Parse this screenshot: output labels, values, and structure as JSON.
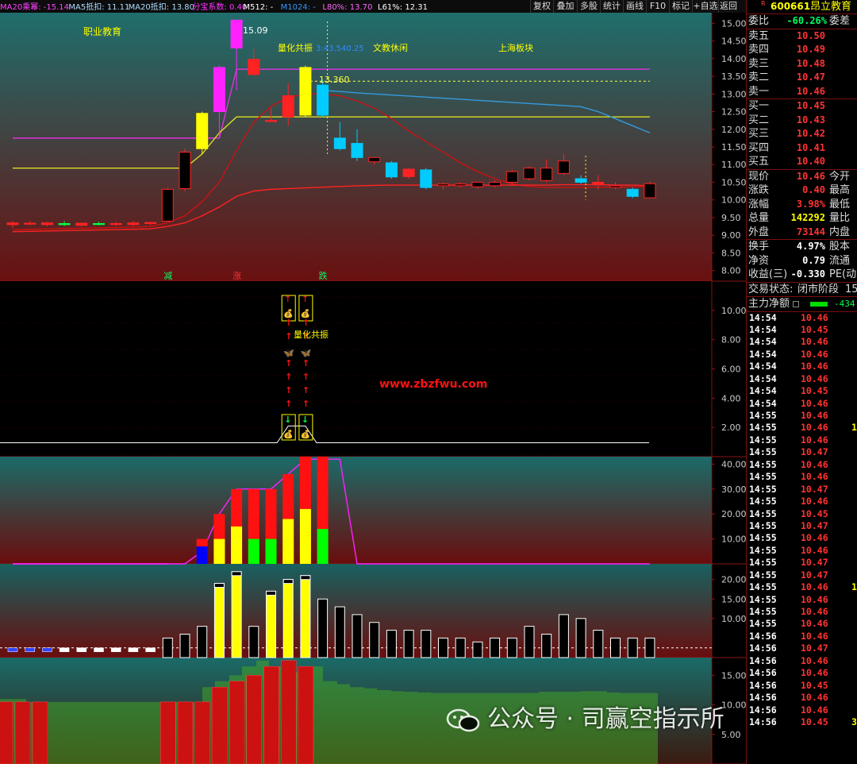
{
  "toolbar": {
    "indicators": [
      {
        "text": "MA20乘幂: -15.14",
        "color": "#ff44ff"
      },
      {
        "text": "MA5抵扣: 11.11",
        "color": "#aaddff"
      },
      {
        "text": "MA20抵扣: 13.80",
        "color": "#aaddff"
      },
      {
        "text": "分宝系数: 0.40",
        "color": "#ff33ff"
      },
      {
        "text": "M512: -",
        "color": "#ffffff"
      },
      {
        "text": "M1024: -",
        "color": "#3399ff"
      },
      {
        "text": "L80%: 13.70",
        "color": "#ff66ff"
      },
      {
        "text": "L61%: 12.31",
        "color": "#ffffff"
      }
    ],
    "buttons": [
      "复权",
      "叠加",
      "多股",
      "统计",
      "画线",
      "F10",
      "标记",
      "+自选",
      "返回"
    ]
  },
  "stock": {
    "flag": "R",
    "code": "600661",
    "name": "昂立教育"
  },
  "main_labels": {
    "tag_left": "职业教育",
    "ref_price": "15.09",
    "ann1": "量化共振",
    "ann1_value": "3:43,540.25",
    "ann2": "文教休闲",
    "ann3": "上海板块",
    "resistance": "13.360"
  },
  "signals": {
    "jian": "减",
    "zhang": "涨",
    "die": "跌"
  },
  "sub1": {
    "resonance": "量化共振",
    "site": "www.zbzfwu.com"
  },
  "orderbook": {
    "weibi": {
      "label": "委比",
      "value": "-60.26%",
      "tail": "委差"
    },
    "asks": [
      {
        "label": "卖五",
        "price": "10.50"
      },
      {
        "label": "卖四",
        "price": "10.49"
      },
      {
        "label": "卖三",
        "price": "10.48"
      },
      {
        "label": "卖二",
        "price": "10.47"
      },
      {
        "label": "卖一",
        "price": "10.46"
      }
    ],
    "bids": [
      {
        "label": "买一",
        "price": "10.45"
      },
      {
        "label": "买二",
        "price": "10.43"
      },
      {
        "label": "买三",
        "price": "10.42"
      },
      {
        "label": "买四",
        "price": "10.41"
      },
      {
        "label": "买五",
        "price": "10.40"
      }
    ]
  },
  "quote": [
    {
      "label": "现价",
      "value": "10.46",
      "tail": "今开",
      "color": "#ff3333"
    },
    {
      "label": "涨跌",
      "value": "0.40",
      "tail": "最高",
      "color": "#ff3333"
    },
    {
      "label": "涨幅",
      "value": "3.98%",
      "tail": "最低",
      "color": "#ff3333"
    },
    {
      "label": "总量",
      "value": "142292",
      "tail": "量比",
      "color": "#ffff00"
    },
    {
      "label": "外盘",
      "value": "73144",
      "tail": "内盘",
      "color": "#ff3333"
    }
  ],
  "finance": [
    {
      "label": "换手",
      "value": "4.97%",
      "tail": "股本"
    },
    {
      "label": "净资",
      "value": "0.79",
      "tail": "流通"
    },
    {
      "label": "收益(三)",
      "value": "-0.330",
      "tail": "PE(动)"
    }
  ],
  "trade_status": {
    "label": "交易状态:",
    "value": "闭市阶段",
    "tail": "15:"
  },
  "main_flow": {
    "label": "主力净额",
    "value": "-434"
  },
  "ticks": [
    {
      "t": "14:54",
      "p": "10.46",
      "v": ""
    },
    {
      "t": "14:54",
      "p": "10.45",
      "v": ""
    },
    {
      "t": "14:54",
      "p": "10.46",
      "v": ""
    },
    {
      "t": "14:54",
      "p": "10.46",
      "v": ""
    },
    {
      "t": "14:54",
      "p": "10.46",
      "v": ""
    },
    {
      "t": "14:54",
      "p": "10.46",
      "v": ""
    },
    {
      "t": "14:54",
      "p": "10.45",
      "v": ""
    },
    {
      "t": "14:54",
      "p": "10.46",
      "v": ""
    },
    {
      "t": "14:55",
      "p": "10.46",
      "v": ""
    },
    {
      "t": "14:55",
      "p": "10.46",
      "v": "1"
    },
    {
      "t": "14:55",
      "p": "10.46",
      "v": ""
    },
    {
      "t": "14:55",
      "p": "10.47",
      "v": ""
    },
    {
      "t": "14:55",
      "p": "10.46",
      "v": ""
    },
    {
      "t": "14:55",
      "p": "10.46",
      "v": ""
    },
    {
      "t": "14:55",
      "p": "10.47",
      "v": ""
    },
    {
      "t": "14:55",
      "p": "10.46",
      "v": ""
    },
    {
      "t": "14:55",
      "p": "10.45",
      "v": ""
    },
    {
      "t": "14:55",
      "p": "10.47",
      "v": ""
    },
    {
      "t": "14:55",
      "p": "10.46",
      "v": ""
    },
    {
      "t": "14:55",
      "p": "10.46",
      "v": ""
    },
    {
      "t": "14:55",
      "p": "10.47",
      "v": ""
    },
    {
      "t": "14:55",
      "p": "10.47",
      "v": ""
    },
    {
      "t": "14:55",
      "p": "10.46",
      "v": "1"
    },
    {
      "t": "14:55",
      "p": "10.46",
      "v": ""
    },
    {
      "t": "14:55",
      "p": "10.46",
      "v": ""
    },
    {
      "t": "14:55",
      "p": "10.46",
      "v": ""
    },
    {
      "t": "14:56",
      "p": "10.46",
      "v": ""
    },
    {
      "t": "14:56",
      "p": "10.47",
      "v": ""
    },
    {
      "t": "14:56",
      "p": "10.46",
      "v": ""
    },
    {
      "t": "14:56",
      "p": "10.46",
      "v": ""
    },
    {
      "t": "14:56",
      "p": "10.45",
      "v": ""
    },
    {
      "t": "14:56",
      "p": "10.46",
      "v": ""
    },
    {
      "t": "14:56",
      "p": "10.46",
      "v": ""
    },
    {
      "t": "14:56",
      "p": "10.45",
      "v": "3"
    }
  ],
  "watermark": "公众号 · 司赢空指示所",
  "axis_ticks": {
    "main": [
      "15.00",
      "14.50",
      "14.00",
      "13.50",
      "13.00",
      "12.50",
      "12.00",
      "11.50",
      "11.00",
      "10.50",
      "10.00",
      "9.50",
      "9.00",
      "8.50",
      "8.00"
    ],
    "sub1": [
      "10.00",
      "8.00",
      "6.00",
      "4.00",
      "2.00"
    ],
    "sub2": [
      "40.00",
      "30.00",
      "20.00",
      "10.00"
    ],
    "sub3": [
      "20.00",
      "15.00",
      "10.00"
    ],
    "sub4": [
      "15.00",
      "10.00",
      "5.00"
    ]
  },
  "chart_data": {
    "type": "candlestick",
    "ylim": [
      7.7,
      15.3
    ],
    "candles": [
      {
        "o": 9.3,
        "h": 9.4,
        "l": 9.2,
        "c": 9.35,
        "color": "red"
      },
      {
        "o": 9.32,
        "h": 9.4,
        "l": 9.28,
        "c": 9.34,
        "color": "red"
      },
      {
        "o": 9.3,
        "h": 9.38,
        "l": 9.25,
        "c": 9.35,
        "color": "red"
      },
      {
        "o": 9.33,
        "h": 9.4,
        "l": 9.26,
        "c": 9.3,
        "color": "green"
      },
      {
        "o": 9.28,
        "h": 9.36,
        "l": 9.24,
        "c": 9.34,
        "color": "red"
      },
      {
        "o": 9.33,
        "h": 9.38,
        "l": 9.28,
        "c": 9.32,
        "color": "green"
      },
      {
        "o": 9.32,
        "h": 9.38,
        "l": 9.26,
        "c": 9.33,
        "color": "red"
      },
      {
        "o": 9.3,
        "h": 9.4,
        "l": 9.25,
        "c": 9.35,
        "color": "red"
      },
      {
        "o": 9.33,
        "h": 9.38,
        "l": 9.28,
        "c": 9.36,
        "color": "red"
      },
      {
        "o": 9.4,
        "h": 10.35,
        "l": 9.38,
        "c": 10.3,
        "color": "red"
      },
      {
        "o": 10.32,
        "h": 11.45,
        "l": 10.25,
        "c": 11.35,
        "color": "red"
      },
      {
        "o": 11.45,
        "h": 12.5,
        "l": 11.3,
        "c": 12.45,
        "color": "yellow"
      },
      {
        "o": 12.5,
        "h": 13.8,
        "l": 11.8,
        "c": 13.75,
        "color": "magenta"
      },
      {
        "o": 14.3,
        "h": 15.09,
        "l": 13.1,
        "c": 15.09,
        "color": "magenta"
      },
      {
        "o": 13.98,
        "h": 14.3,
        "l": 13.5,
        "c": 13.55,
        "color": "red"
      },
      {
        "o": 12.25,
        "h": 12.6,
        "l": 12.2,
        "c": 12.22,
        "color": "red"
      },
      {
        "o": 12.95,
        "h": 13.3,
        "l": 12.1,
        "c": 12.35,
        "color": "red"
      },
      {
        "o": 13.75,
        "h": 13.8,
        "l": 12.35,
        "c": 12.4,
        "color": "yellow"
      },
      {
        "o": 13.25,
        "h": 13.4,
        "l": 12.35,
        "c": 12.4,
        "color": "cyan"
      },
      {
        "o": 11.75,
        "h": 12.2,
        "l": 11.4,
        "c": 11.45,
        "color": "cyan"
      },
      {
        "o": 11.6,
        "h": 12.0,
        "l": 11.1,
        "c": 11.2,
        "color": "cyan"
      },
      {
        "o": 11.08,
        "h": 11.2,
        "l": 11.0,
        "c": 11.2,
        "color": "red"
      },
      {
        "o": 11.05,
        "h": 11.1,
        "l": 10.6,
        "c": 10.65,
        "color": "cyan"
      },
      {
        "o": 10.87,
        "h": 10.9,
        "l": 10.6,
        "c": 10.66,
        "color": "red"
      },
      {
        "o": 10.85,
        "h": 10.9,
        "l": 10.3,
        "c": 10.35,
        "color": "cyan"
      },
      {
        "o": 10.4,
        "h": 10.5,
        "l": 10.3,
        "c": 10.45,
        "color": "red"
      },
      {
        "o": 10.4,
        "h": 10.5,
        "l": 10.35,
        "c": 10.45,
        "color": "red"
      },
      {
        "o": 10.37,
        "h": 10.5,
        "l": 10.32,
        "c": 10.5,
        "color": "red"
      },
      {
        "o": 10.4,
        "h": 10.55,
        "l": 10.35,
        "c": 10.5,
        "color": "red"
      },
      {
        "o": 10.5,
        "h": 10.85,
        "l": 10.4,
        "c": 10.8,
        "color": "red"
      },
      {
        "o": 10.6,
        "h": 10.95,
        "l": 10.55,
        "c": 10.9,
        "color": "red"
      },
      {
        "o": 10.55,
        "h": 11.15,
        "l": 10.5,
        "c": 10.9,
        "color": "red"
      },
      {
        "o": 10.75,
        "h": 11.3,
        "l": 10.7,
        "c": 11.1,
        "color": "red"
      },
      {
        "o": 10.6,
        "h": 10.7,
        "l": 10.45,
        "c": 10.5,
        "color": "cyan"
      },
      {
        "o": 10.5,
        "h": 10.7,
        "l": 10.3,
        "c": 10.45,
        "color": "red"
      },
      {
        "o": 10.35,
        "h": 10.5,
        "l": 10.3,
        "c": 10.4,
        "color": "red"
      },
      {
        "o": 10.3,
        "h": 10.35,
        "l": 10.05,
        "c": 10.1,
        "color": "cyan"
      },
      {
        "o": 10.06,
        "h": 10.52,
        "l": 10.05,
        "c": 10.46,
        "color": "red"
      }
    ],
    "ma_red": [
      9.15,
      9.17,
      9.18,
      9.19,
      9.2,
      9.21,
      9.22,
      9.23,
      9.25,
      9.35,
      9.55,
      9.95,
      10.5,
      11.4,
      12.2,
      12.65,
      12.9,
      13.0,
      13.0,
      12.95,
      12.8,
      12.6,
      12.3,
      11.95,
      11.65,
      11.35,
      11.05,
      10.8,
      10.6,
      10.45,
      10.38,
      10.35,
      10.35,
      10.35,
      10.36,
      10.36,
      10.37,
      10.38
    ],
    "ma_red_low": [
      9.1,
      9.11,
      9.12,
      9.13,
      9.14,
      9.15,
      9.16,
      9.17,
      9.18,
      9.25,
      9.35,
      9.55,
      9.8,
      10.1,
      10.25,
      10.3,
      10.32,
      10.34,
      10.36,
      10.38,
      10.4,
      10.41,
      10.42,
      10.42,
      10.42,
      10.42,
      10.42,
      10.42,
      10.42,
      10.42,
      10.42,
      10.42,
      10.43,
      10.43,
      10.43,
      10.42,
      10.42,
      10.4
    ],
    "ma_blue": {
      "start_index": 18,
      "values": [
        13.1,
        13.07,
        13.03,
        13.0,
        12.97,
        12.94,
        12.91,
        12.88,
        12.85,
        12.82,
        12.79,
        12.76,
        12.73,
        12.7,
        12.67,
        12.64,
        12.5,
        12.3,
        12.1,
        11.9
      ]
    },
    "ma_yellow": [
      10.9,
      10.9,
      10.9,
      10.9,
      10.9,
      10.9,
      10.9,
      10.9,
      10.9,
      10.9,
      10.9,
      11.3,
      11.9,
      12.35,
      12.35,
      12.35,
      12.35,
      12.35,
      12.35,
      12.35,
      12.35,
      12.35,
      12.35,
      12.35,
      12.35,
      12.35,
      12.35,
      12.35,
      12.35,
      12.35,
      12.35,
      12.35,
      12.35,
      12.35,
      12.35,
      12.35,
      12.35,
      12.35
    ],
    "ma_magenta": [
      11.75,
      11.75,
      11.75,
      11.75,
      11.75,
      11.75,
      11.75,
      11.75,
      11.75,
      11.75,
      11.75,
      11.75,
      11.75,
      13.7,
      13.7,
      13.7,
      13.7,
      13.7,
      13.7,
      13.7,
      13.7,
      13.7,
      13.7,
      13.7,
      13.7,
      13.7,
      13.7,
      13.7,
      13.7,
      13.7,
      13.7,
      13.7,
      13.7,
      13.7,
      13.7,
      13.7,
      13.7,
      13.7
    ],
    "resistance_level": 13.36,
    "sub1_signal": {
      "ylim": [
        0,
        12
      ],
      "baseline": 0.95,
      "peak": 2.1,
      "signal_index": [
        16,
        17
      ]
    },
    "sub2": {
      "ylim": [
        0,
        43
      ],
      "line": [
        0,
        0,
        0,
        0,
        0,
        0,
        0,
        0,
        0,
        0,
        0,
        5,
        20,
        30,
        30,
        30,
        36,
        42,
        42,
        42,
        0,
        0,
        0,
        0,
        0,
        0,
        0,
        0,
        0,
        0,
        0,
        0,
        0,
        0,
        0,
        0,
        0,
        0
      ],
      "bars": [
        {
          "i": 11,
          "red": 10,
          "base": 7,
          "base_color": "#0000ff"
        },
        {
          "i": 12,
          "red": 20,
          "base": 10,
          "base_color": "#ffff00"
        },
        {
          "i": 13,
          "red": 30,
          "base": 15,
          "base_color": "#ffff00"
        },
        {
          "i": 14,
          "red": 30,
          "base": 10,
          "base_color": "#00ff00"
        },
        {
          "i": 15,
          "red": 30,
          "base": 10,
          "base_color": "#00ff00"
        },
        {
          "i": 16,
          "red": 36,
          "base": 18,
          "base_color": "#ffff00"
        },
        {
          "i": 17,
          "red": 43,
          "base": 22,
          "base_color": "#ffff00"
        },
        {
          "i": 18,
          "red": 43,
          "base": 14,
          "base_color": "#00ff00"
        }
      ]
    },
    "sub3": {
      "ylim": [
        0,
        24
      ],
      "dash_level": 2.5,
      "values": [
        1.5,
        1.5,
        1.5,
        1,
        1,
        1,
        1,
        1,
        1,
        5,
        6,
        8,
        19,
        22,
        8,
        17,
        20,
        21,
        15,
        13,
        11,
        9,
        7,
        7,
        7,
        5,
        5,
        4,
        5,
        5,
        8,
        6,
        11,
        10,
        7,
        5,
        5,
        5,
        5,
        7
      ],
      "fill": [
        "#3344ff",
        "#3344ff",
        "#3344ff",
        "#ffffff",
        "#ffffff",
        "#ffffff",
        "#ffffff",
        "#ffffff",
        "#ffffff",
        "",
        "",
        "",
        "#ffff00",
        "#ffff00",
        "",
        "#ffff00",
        "#ffff00",
        "#ffff00",
        "",
        "",
        "",
        "",
        "",
        "",
        "",
        "",
        "",
        "",
        "",
        "",
        "",
        "",
        "",
        "",
        "",
        "",
        "",
        ""
      ]
    },
    "sub4": {
      "ylim": [
        0,
        18
      ],
      "bars": [
        11,
        11,
        10.5,
        10.5,
        10.5,
        10.5,
        10.5,
        10.5,
        10.5,
        10.5,
        10.5,
        10.5,
        10.5,
        10.5,
        10.5,
        13,
        14,
        15,
        16.5,
        17.5,
        16.5,
        15.5,
        15.5,
        16.5,
        14,
        13.5,
        13,
        12.8,
        12.5,
        12.3,
        12.2,
        12.1,
        12,
        12,
        12,
        12,
        12,
        12,
        12,
        12,
        12.2,
        12.2,
        12.2,
        12.3,
        12.3,
        12.1,
        12,
        12,
        12
      ],
      "red_range": [
        0,
        1,
        2,
        9,
        10,
        11,
        12,
        13,
        14,
        15,
        16,
        17
      ]
    }
  }
}
